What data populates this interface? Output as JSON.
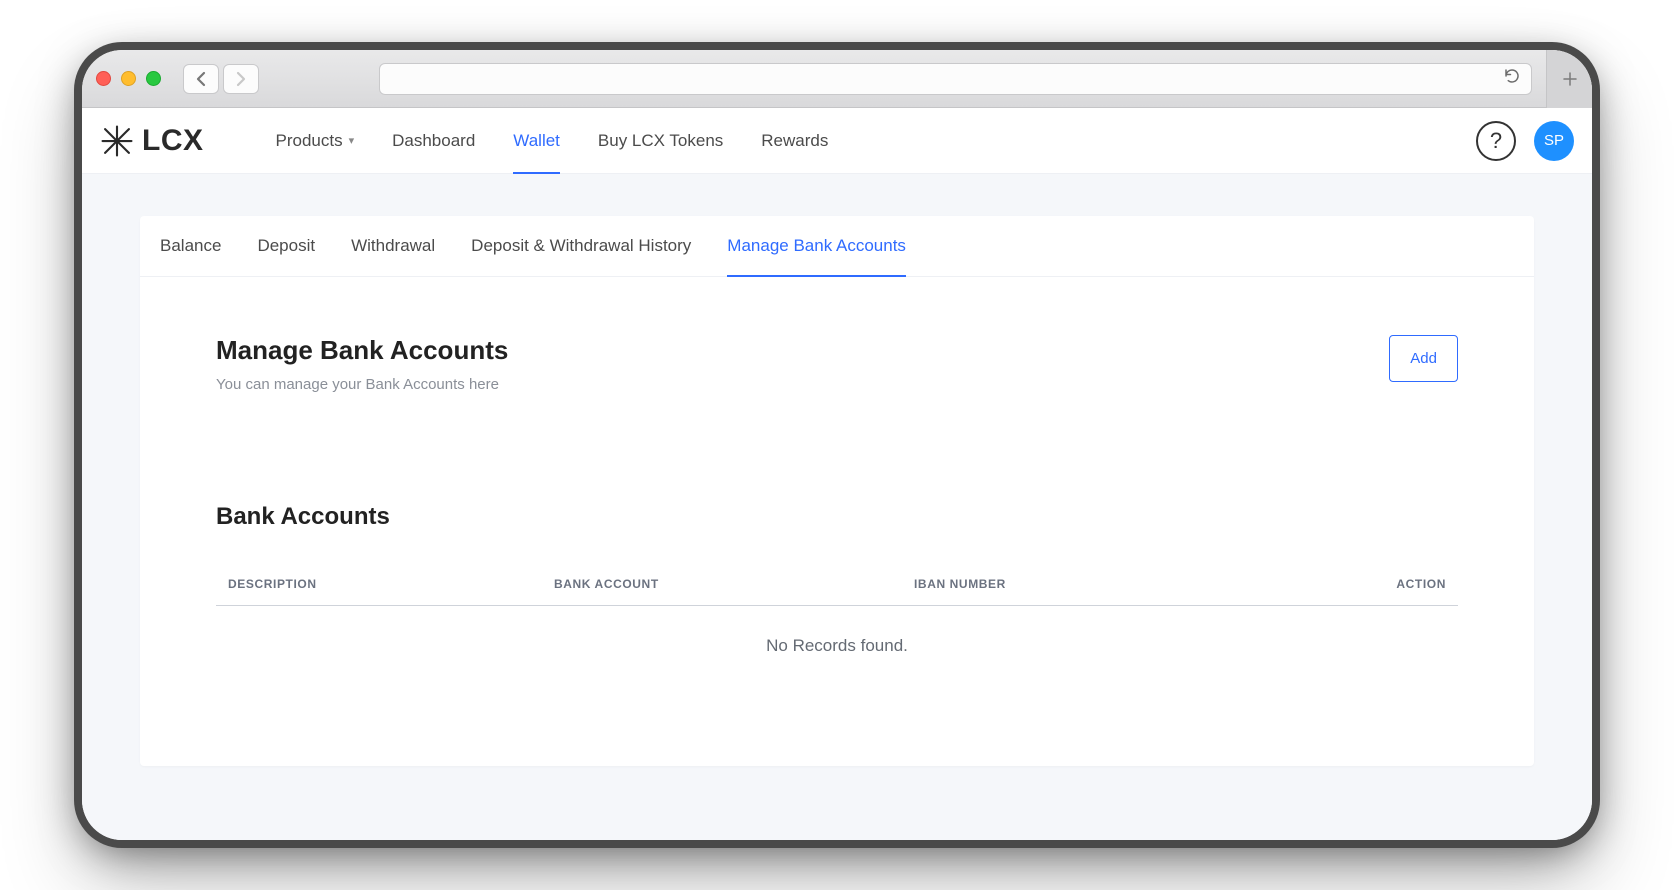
{
  "browser": {
    "address": ""
  },
  "brand": "LCX",
  "avatar_initials": "SP",
  "main_tabs": [
    {
      "label": "Products",
      "has_dropdown": true,
      "active": false
    },
    {
      "label": "Dashboard",
      "has_dropdown": false,
      "active": false
    },
    {
      "label": "Wallet",
      "has_dropdown": false,
      "active": true
    },
    {
      "label": "Buy LCX Tokens",
      "has_dropdown": false,
      "active": false
    },
    {
      "label": "Rewards",
      "has_dropdown": false,
      "active": false
    }
  ],
  "sub_tabs": [
    {
      "label": "Balance",
      "active": false
    },
    {
      "label": "Deposit",
      "active": false
    },
    {
      "label": "Withdrawal",
      "active": false
    },
    {
      "label": "Deposit & Withdrawal History",
      "active": false
    },
    {
      "label": "Manage Bank Accounts",
      "active": true
    }
  ],
  "page": {
    "title": "Manage Bank Accounts",
    "subtitle": "You can manage your Bank Accounts here",
    "add_button": "Add"
  },
  "table": {
    "title": "Bank Accounts",
    "columns": {
      "description": "DESCRIPTION",
      "bank_account": "BANK ACCOUNT",
      "iban": "IBAN NUMBER",
      "action": "ACTION"
    },
    "empty_message": "No Records found.",
    "rows": []
  }
}
